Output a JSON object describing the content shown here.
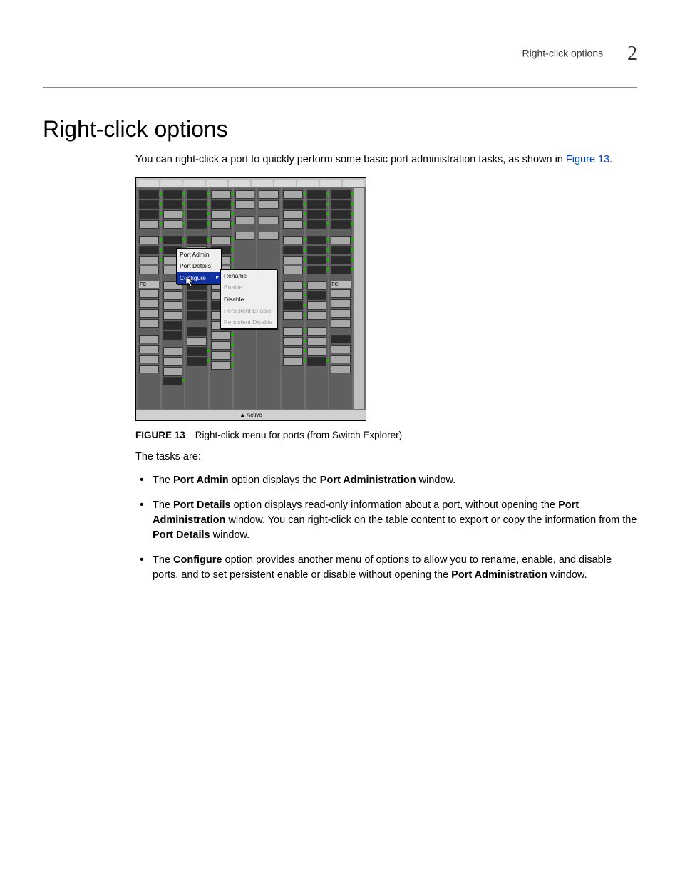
{
  "header": {
    "running": "Right-click options",
    "chapter_number": "2"
  },
  "section": {
    "title": "Right-click options",
    "intro_pre": "You can right-click a port to quickly perform some basic port administration tasks, as shown in ",
    "intro_link": "Figure 13",
    "intro_post": "."
  },
  "figure": {
    "label": "FIGURE 13",
    "caption": "Right-click menu for ports (from Switch Explorer)",
    "statusbar": "▲ Active",
    "context_menu": {
      "items": [
        "Port Admin",
        "Port Details",
        "Configure"
      ],
      "selected_index": 2
    },
    "submenu": {
      "items": [
        {
          "label": "Rename",
          "enabled": true
        },
        {
          "label": "Enable",
          "enabled": false
        },
        {
          "label": "Disable",
          "enabled": true
        },
        {
          "label": "Persistent Enable",
          "enabled": false
        },
        {
          "label": "Persistent Disable",
          "enabled": false
        }
      ]
    },
    "fc_label": "FC"
  },
  "tasks_intro": "The tasks are:",
  "tasks": [
    {
      "parts": [
        {
          "t": "The "
        },
        {
          "t": "Port Admin",
          "b": true
        },
        {
          "t": " option displays the "
        },
        {
          "t": "Port Administration",
          "b": true
        },
        {
          "t": " window."
        }
      ]
    },
    {
      "parts": [
        {
          "t": "The "
        },
        {
          "t": "Port Details",
          "b": true
        },
        {
          "t": " option displays read-only information about a port, without opening the "
        },
        {
          "t": "Port Administration",
          "b": true
        },
        {
          "t": " window. You can right-click on the table content to export or copy the information from the "
        },
        {
          "t": "Port Details",
          "b": true
        },
        {
          "t": " window."
        }
      ]
    },
    {
      "parts": [
        {
          "t": "The "
        },
        {
          "t": "Configure",
          "b": true
        },
        {
          "t": " option provides another menu of options to allow you to rename, enable, and disable ports, and to set persistent enable or disable without opening the "
        },
        {
          "t": "Port Administration",
          "b": true
        },
        {
          "t": " window."
        }
      ]
    }
  ]
}
